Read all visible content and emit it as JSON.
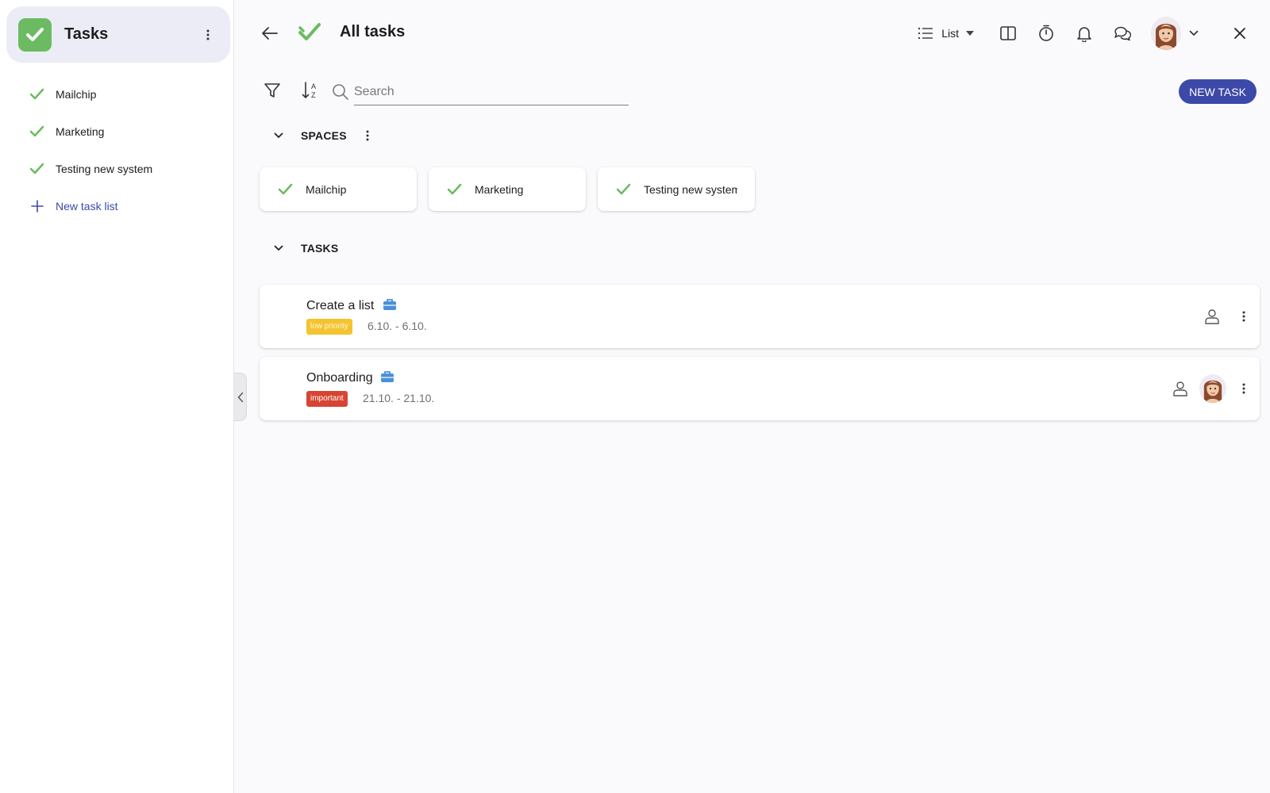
{
  "sidebar": {
    "app_title": "Tasks",
    "items": [
      {
        "label": "Mailchip",
        "icon": "check-icon"
      },
      {
        "label": "Marketing",
        "icon": "check-icon"
      },
      {
        "label": "Testing new system",
        "icon": "check-icon"
      }
    ],
    "new_item_label": "New task list"
  },
  "header": {
    "title": "All tasks",
    "view_mode": "List"
  },
  "toolbar": {
    "search_placeholder": "Search",
    "new_task_label": "NEW TASK"
  },
  "spaces": {
    "label": "SPACES",
    "items": [
      {
        "label": "Mailchip"
      },
      {
        "label": "Marketing"
      },
      {
        "label": "Testing new system"
      }
    ]
  },
  "tasks": {
    "label": "TASKS",
    "items": [
      {
        "name": "Create a list",
        "tag": "low priority",
        "dates": "6.10. - 6.10."
      },
      {
        "name": "Onboarding",
        "tag": "important",
        "dates": "21.10. - 21.10."
      }
    ]
  },
  "colors": {
    "accent": "#3d49a8",
    "check_green": "#6cbb62",
    "low_priority": "#f4c430",
    "important": "#d84432",
    "briefcase": "#4a90d9"
  }
}
